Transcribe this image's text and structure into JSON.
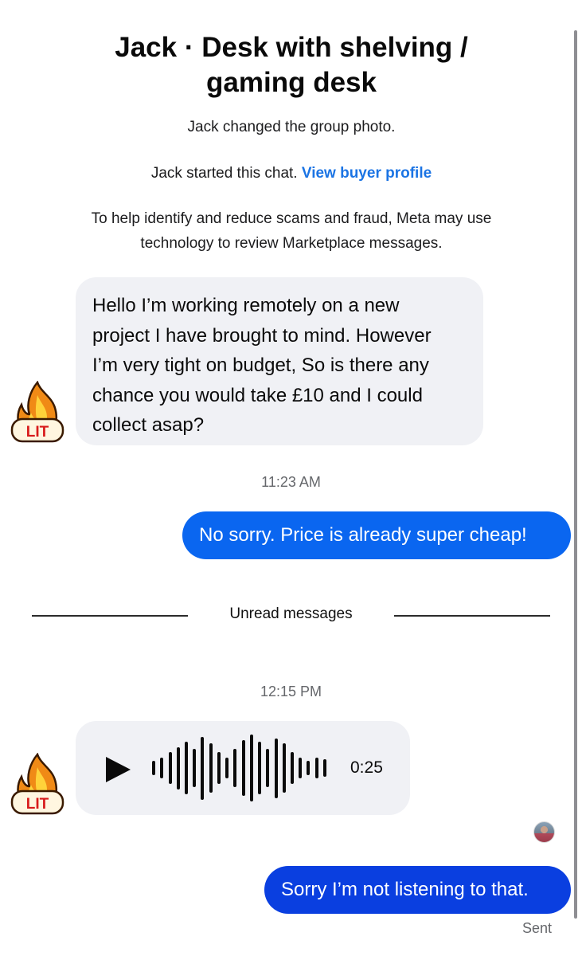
{
  "header": {
    "title_line1": "Jack · Desk with shelving /",
    "title_line2": "gaming desk"
  },
  "system": {
    "group_photo": "Jack changed the group photo.",
    "started_prefix": "Jack started this chat.",
    "view_profile": "View buyer profile",
    "notice_line1": "To help identify and reduce scams and fraud, Meta may use",
    "notice_line2": "technology to review Marketplace messages."
  },
  "messages": {
    "incoming_1": [
      "Hello I’m working remotely on a new",
      "project I have brought to mind. However",
      "I’m very tight on budget, So is there any",
      "chance you would take £10 and I could",
      "collect asap?"
    ],
    "time_1": "11:23 AM",
    "outgoing_1": "No sorry. Price is already super cheap!",
    "unread_label": "Unread messages",
    "time_2": "12:15 PM",
    "voice_duration": "0:25",
    "outgoing_2": "Sorry I’m not listening to that.",
    "status": "Sent"
  },
  "sticker": {
    "icon": "lit-fire-icon",
    "text": "LIT"
  },
  "voice": {
    "icon": "play-icon",
    "waveform_levels": [
      0.2,
      0.3,
      0.45,
      0.6,
      0.75,
      0.55,
      0.9,
      0.7,
      0.45,
      0.3,
      0.55,
      0.8,
      0.95,
      0.75,
      0.55,
      0.85,
      0.7,
      0.45,
      0.3,
      0.2,
      0.3,
      0.25
    ]
  },
  "colors": {
    "accent_link": "#1b74e4",
    "outgoing_bubble_1": "#0a66f0",
    "outgoing_bubble_2": "#0a3fe0",
    "incoming_bubble": "#f0f1f5"
  }
}
